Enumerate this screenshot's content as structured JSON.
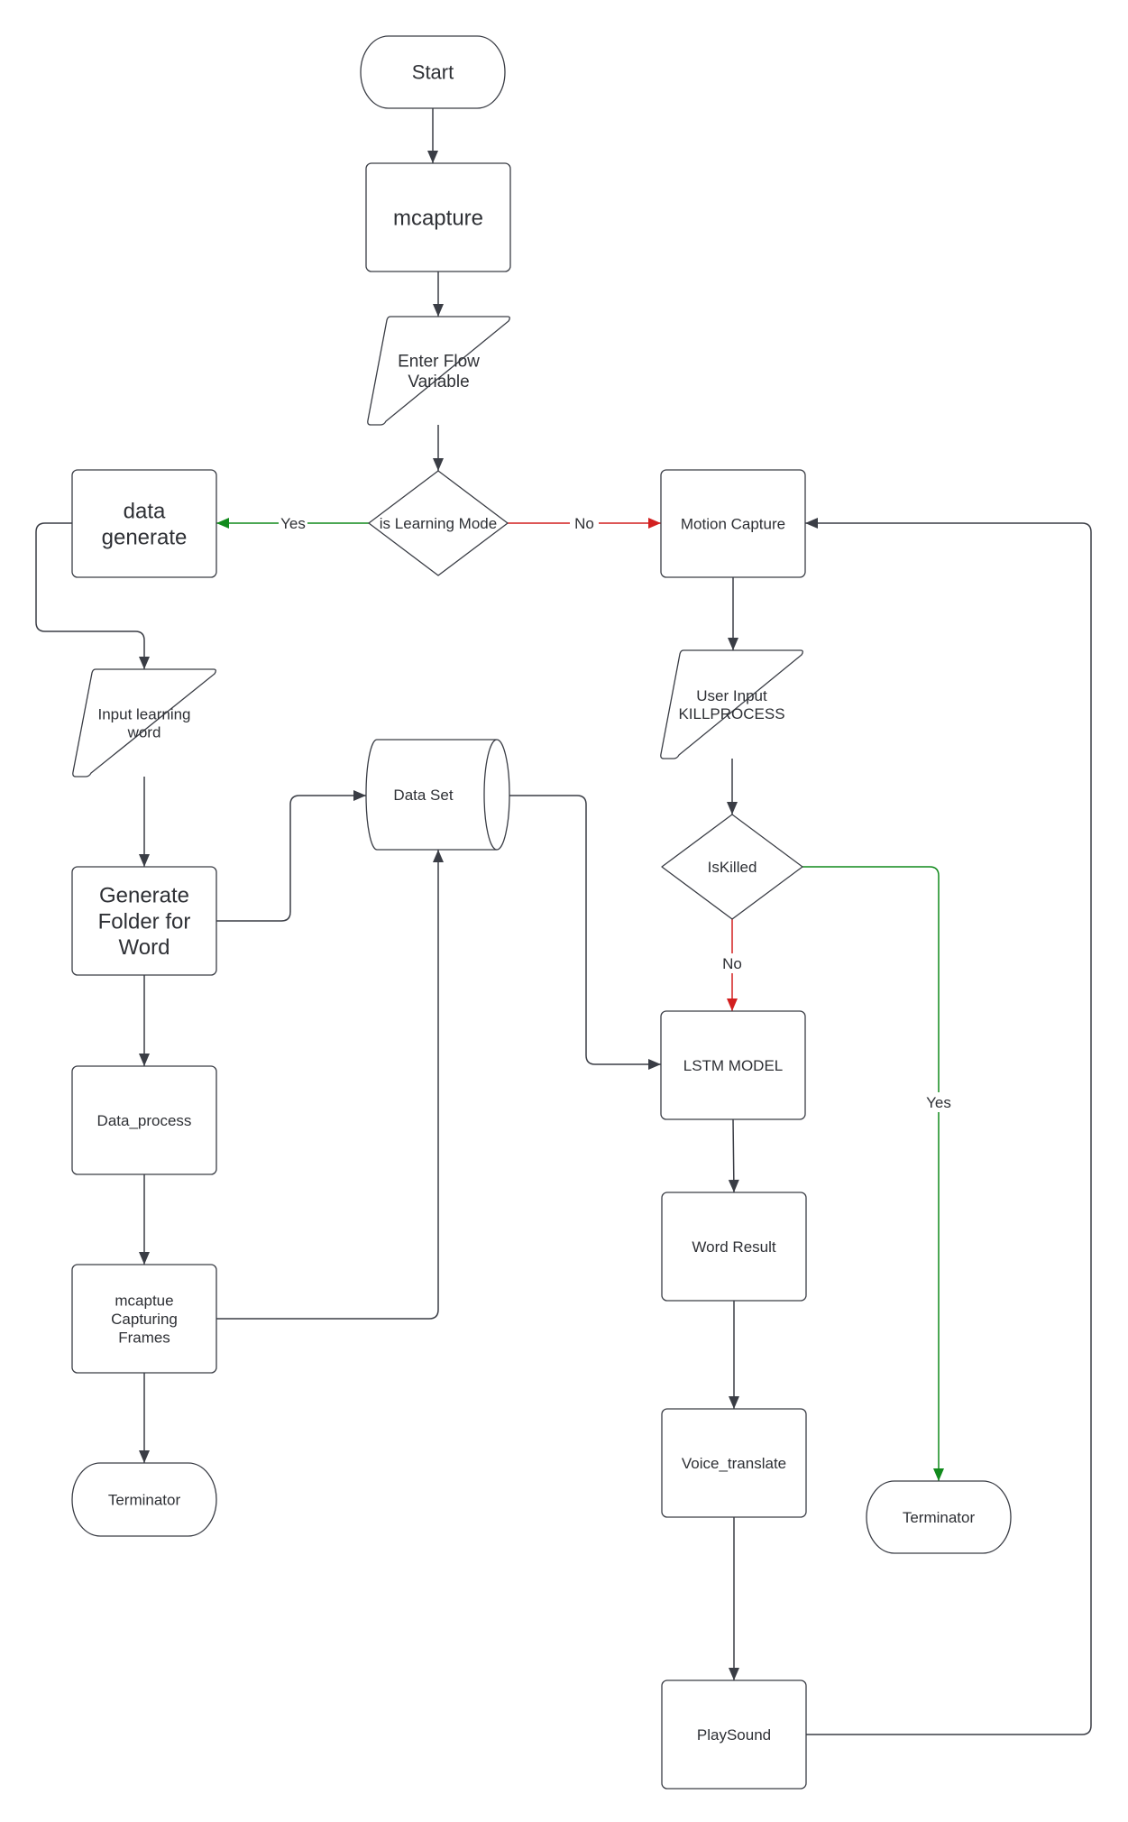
{
  "colors": {
    "default": "#3a3d45",
    "yes": "#118a1c",
    "no": "#d21f1f"
  },
  "nodes": {
    "start": {
      "shape": "terminator",
      "lines": [
        "Start"
      ]
    },
    "mcapture": {
      "shape": "process",
      "lines": [
        "mcapture"
      ]
    },
    "enter_flow": {
      "shape": "data",
      "lines": [
        "Enter Flow",
        "Variable"
      ]
    },
    "is_learning": {
      "shape": "decision",
      "lines": [
        "is Learning Mode"
      ]
    },
    "data_generate": {
      "shape": "process",
      "lines": [
        "data",
        "generate"
      ]
    },
    "motion_capture": {
      "shape": "process",
      "lines": [
        "Motion Capture"
      ]
    },
    "input_word": {
      "shape": "data",
      "lines": [
        "Input learning",
        "word"
      ]
    },
    "data_set": {
      "shape": "database",
      "lines": [
        "Data Set"
      ]
    },
    "user_input": {
      "shape": "data",
      "lines": [
        "User Input",
        "KILLPROCESS"
      ]
    },
    "is_killed": {
      "shape": "decision",
      "lines": [
        "IsKilled"
      ]
    },
    "gen_folder": {
      "shape": "process",
      "lines": [
        "Generate",
        "Folder for",
        "Word"
      ]
    },
    "lstm": {
      "shape": "process",
      "lines": [
        "LSTM MODEL"
      ]
    },
    "data_process": {
      "shape": "process",
      "lines": [
        "Data_process"
      ]
    },
    "word_result": {
      "shape": "process",
      "lines": [
        "Word Result"
      ]
    },
    "mcaptue": {
      "shape": "process",
      "lines": [
        "mcaptue",
        "Capturing",
        "Frames"
      ]
    },
    "voice": {
      "shape": "process",
      "lines": [
        "Voice_translate"
      ]
    },
    "term_left": {
      "shape": "terminator",
      "lines": [
        "Terminator"
      ]
    },
    "term_right": {
      "shape": "terminator",
      "lines": [
        "Terminator"
      ]
    },
    "playsound": {
      "shape": "process",
      "lines": [
        "PlaySound"
      ]
    }
  },
  "edges": [
    {
      "from": "start",
      "to": "mcapture",
      "color": "default"
    },
    {
      "from": "mcapture",
      "to": "enter_flow",
      "color": "default"
    },
    {
      "from": "enter_flow",
      "to": "is_learning",
      "color": "default"
    },
    {
      "from": "is_learning",
      "to": "data_generate",
      "label": "Yes",
      "color": "yes"
    },
    {
      "from": "is_learning",
      "to": "motion_capture",
      "label": "No",
      "color": "no"
    },
    {
      "from": "data_generate",
      "to": "input_word",
      "color": "default"
    },
    {
      "from": "input_word",
      "to": "gen_folder",
      "color": "default"
    },
    {
      "from": "gen_folder",
      "to": "data_set",
      "color": "default"
    },
    {
      "from": "gen_folder",
      "to": "data_process",
      "color": "default"
    },
    {
      "from": "data_process",
      "to": "mcaptue",
      "color": "default"
    },
    {
      "from": "mcaptue",
      "to": "data_set",
      "color": "default"
    },
    {
      "from": "mcaptue",
      "to": "term_left",
      "color": "default"
    },
    {
      "from": "data_set",
      "to": "lstm",
      "color": "default"
    },
    {
      "from": "motion_capture",
      "to": "user_input",
      "color": "default"
    },
    {
      "from": "user_input",
      "to": "is_killed",
      "color": "default"
    },
    {
      "from": "is_killed",
      "to": "lstm",
      "label": "No",
      "color": "no"
    },
    {
      "from": "is_killed",
      "to": "term_right",
      "label": "Yes",
      "color": "yes"
    },
    {
      "from": "lstm",
      "to": "word_result",
      "color": "default"
    },
    {
      "from": "word_result",
      "to": "voice",
      "color": "default"
    },
    {
      "from": "voice",
      "to": "playsound",
      "color": "default"
    },
    {
      "from": "playsound",
      "to": "motion_capture",
      "color": "default"
    }
  ]
}
